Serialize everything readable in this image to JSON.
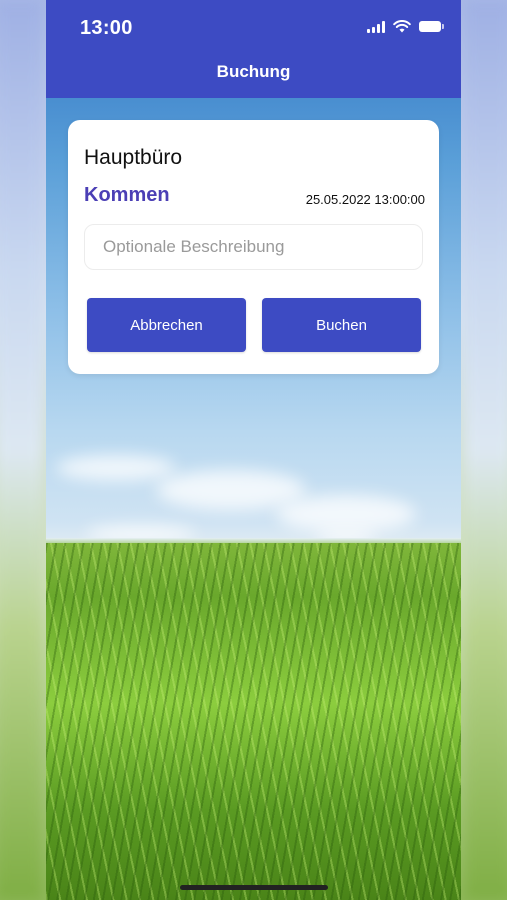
{
  "status_bar": {
    "time": "13:00"
  },
  "nav": {
    "title": "Buchung"
  },
  "card": {
    "location": "Hauptbüro",
    "action": "Kommen",
    "datetime": "25.05.2022 13:00:00",
    "description_placeholder": "Optionale Beschreibung",
    "description_value": "",
    "cancel_label": "Abbrechen",
    "book_label": "Buchen"
  },
  "colors": {
    "primary": "#3d4bc3",
    "action_text": "#4b3fb5",
    "card_bg": "#ffffff"
  },
  "icons": [
    "signal-icon",
    "wifi-icon",
    "battery-icon"
  ]
}
